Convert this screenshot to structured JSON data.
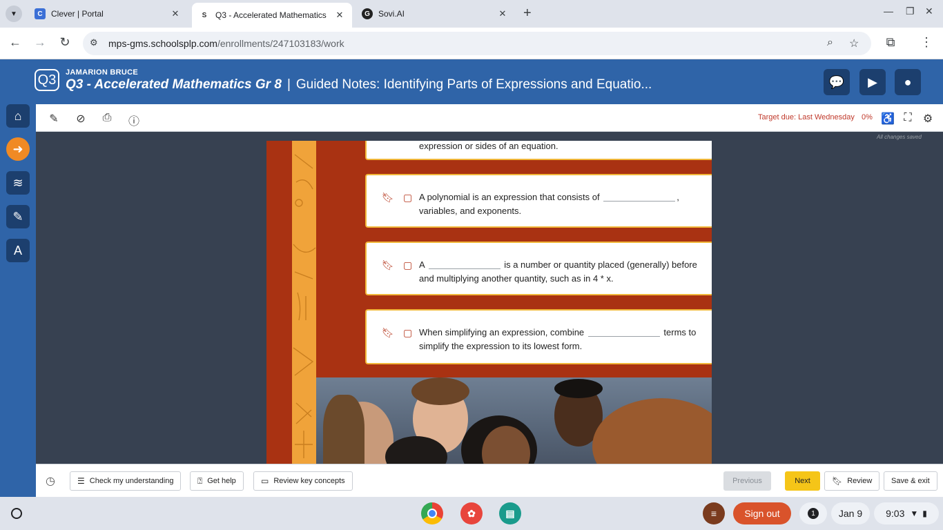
{
  "browser": {
    "tabs": [
      {
        "title": "Clever | Portal",
        "favicon": "C",
        "favicon_color": "#3b6fd6"
      },
      {
        "title": "Q3 - Accelerated Mathematics",
        "favicon": "S",
        "favicon_color": "#444444"
      },
      {
        "title": "Sovi.AI",
        "favicon": "G",
        "favicon_color": "#222222"
      }
    ],
    "url_host": "mps-gms.schoolsplp.com",
    "url_path": "/enrollments/247103183/work"
  },
  "header": {
    "logo": "Q3",
    "student_name": "JAMARION BRUCE",
    "course": "Q3 - Accelerated Mathematics Gr 8",
    "separator": "|",
    "lesson": "Guided Notes: Identifying Parts of Expressions and Equatio..."
  },
  "toolbar": {
    "target_due": "Target due: Last Wednesday",
    "progress": "0%",
    "saved_status": "All changes saved"
  },
  "notes": [
    {
      "before": "expression or sides of an equation.",
      "after": ""
    },
    {
      "before": "A polynomial is an expression that consists of",
      "after": ", variables, and exponents."
    },
    {
      "before": "A",
      "after": "is a number or quantity placed (generally) before and multiplying another quantity, such as in 4 * x."
    },
    {
      "before": "When simplifying an expression, combine",
      "after": "terms to simplify the expression to its lowest form."
    }
  ],
  "bottom": {
    "check": "Check my understanding",
    "help": "Get help",
    "review_concepts": "Review key concepts",
    "previous": "Previous",
    "next": "Next",
    "review": "Review",
    "save_exit": "Save & exit"
  },
  "shelf": {
    "sign_out": "Sign out",
    "notifications": "1",
    "date": "Jan 9",
    "time": "9:03"
  },
  "colors": {
    "header_blue": "#2f64a8",
    "doc_red": "#a93212",
    "next_yellow": "#f5c518",
    "due_red": "#c0392b"
  }
}
